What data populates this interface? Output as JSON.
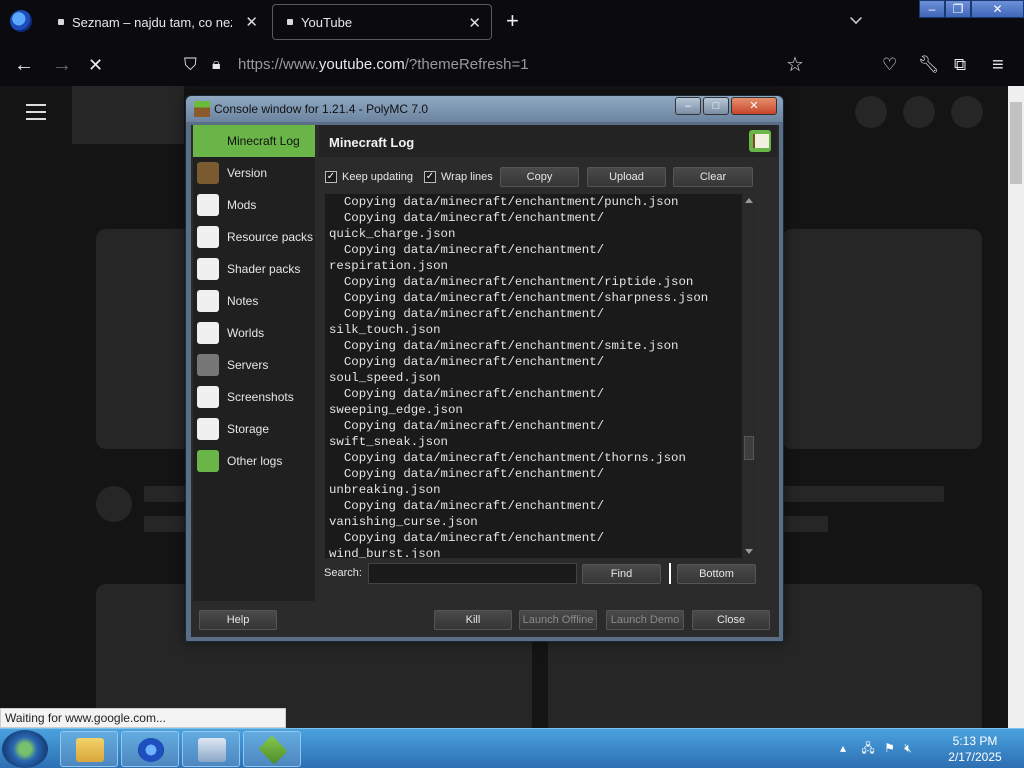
{
  "browser": {
    "tabs": [
      {
        "title": "Seznam – najdu tam, co neznám"
      },
      {
        "title": "YouTube"
      }
    ],
    "url_prefix": "https://www.",
    "url_host": "youtube.com",
    "url_path": "/?themeRefresh=1",
    "status_text": "Waiting for www.google.com..."
  },
  "dialog": {
    "title": "Console window for 1.21.4 - PolyMC 7.0",
    "sidebar": [
      {
        "label": "Minecraft Log",
        "icon": "book-icon",
        "color": "#6ab547"
      },
      {
        "label": "Version",
        "icon": "grass-block-icon",
        "color": "#7a5a2f"
      },
      {
        "label": "Mods",
        "icon": "star-icon",
        "color": "#f0f0f0"
      },
      {
        "label": "Resource packs",
        "icon": "briefcase-icon",
        "color": "#f0f0f0"
      },
      {
        "label": "Shader packs",
        "icon": "cube-icon",
        "color": "#f0f0f0"
      },
      {
        "label": "Notes",
        "icon": "note-icon",
        "color": "#f0f0f0"
      },
      {
        "label": "Worlds",
        "icon": "globe-icon",
        "color": "#f0f0f0"
      },
      {
        "label": "Servers",
        "icon": "server-icon",
        "color": "#777777"
      },
      {
        "label": "Screenshots",
        "icon": "picture-icon",
        "color": "#f0f0f0"
      },
      {
        "label": "Storage",
        "icon": "storage-icon",
        "color": "#f0f0f0"
      },
      {
        "label": "Other logs",
        "icon": "book-icon",
        "color": "#6ab547"
      }
    ],
    "page_title": "Minecraft Log",
    "keep_updating": "Keep updating",
    "wrap_lines": "Wrap lines",
    "copy": "Copy",
    "upload": "Upload",
    "clear": "Clear",
    "log_lines": [
      "  Copying data/minecraft/enchantment/punch.json",
      "  Copying data/minecraft/enchantment/",
      "quick_charge.json",
      "  Copying data/minecraft/enchantment/",
      "respiration.json",
      "  Copying data/minecraft/enchantment/riptide.json",
      "  Copying data/minecraft/enchantment/sharpness.json",
      "  Copying data/minecraft/enchantment/",
      "silk_touch.json",
      "  Copying data/minecraft/enchantment/smite.json",
      "  Copying data/minecraft/enchantment/",
      "soul_speed.json",
      "  Copying data/minecraft/enchantment/",
      "sweeping_edge.json",
      "  Copying data/minecraft/enchantment/",
      "swift_sneak.json",
      "  Copying data/minecraft/enchantment/thorns.json",
      "  Copying data/minecraft/enchantment/",
      "unbreaking.json",
      "  Copying data/minecraft/enchantment/",
      "vanishing_curse.json",
      "  Copying data/minecraft/enchantment/",
      "wind_burst.json"
    ],
    "search_label": "Search:",
    "search_value": "",
    "find": "Find",
    "bottom": "Bottom",
    "help": "Help",
    "kill": "Kill",
    "launch_offline": "Launch Offline",
    "launch_demo": "Launch Demo",
    "close": "Close"
  },
  "taskbar": {
    "time": "5:13 PM",
    "date": "2/17/2025"
  }
}
